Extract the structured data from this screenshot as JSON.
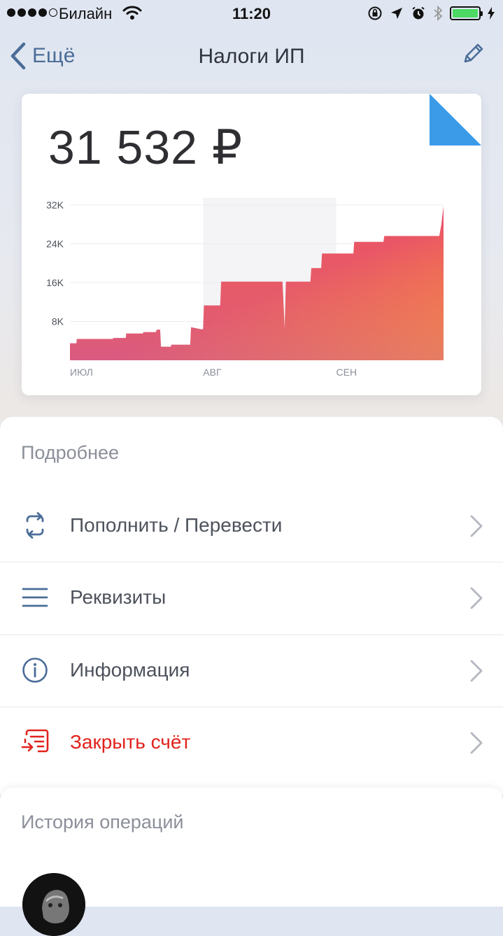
{
  "status_bar": {
    "carrier": "Билайн",
    "time": "11:20",
    "battery_level": 1.0,
    "icons": [
      "signal-dots-icon",
      "wifi-icon",
      "orientation-lock-icon",
      "location-icon",
      "alarm-icon",
      "bluetooth-icon",
      "battery-icon",
      "charging-icon"
    ]
  },
  "nav": {
    "back_label": "Ещё",
    "title": "Налоги ИП",
    "edit_icon": "pencil-icon"
  },
  "balance": {
    "amount": "31 532 ₽"
  },
  "colors": {
    "accent": "#4a6d99",
    "danger": "#e0241d",
    "corner_flag": "#3b9be8",
    "chart_top": "#ff9232",
    "chart_mid": "#e8506a",
    "chart_bottom": "#c8659a"
  },
  "chart_data": {
    "type": "area",
    "title": "",
    "xlabel": "",
    "ylabel": "",
    "ylim": [
      0,
      32000
    ],
    "y_ticks": [
      "32K",
      "24K",
      "16K",
      "8K"
    ],
    "y_tick_values": [
      32000,
      24000,
      16000,
      8000
    ],
    "x_tick_labels": [
      "ИЮЛ",
      "АВГ",
      "СЕН"
    ],
    "x_tick_days": [
      0,
      31,
      62
    ],
    "xlim": [
      0,
      87
    ],
    "grid": true,
    "series": [
      {
        "x": [
          0,
          1.5,
          1.6,
          10,
          10.1,
          13,
          13.1,
          17,
          17.1,
          20,
          20.2,
          21,
          21.2,
          23.5,
          23.6,
          28,
          28.2,
          30.5,
          31,
          31.2,
          35,
          35.2,
          49.5,
          50,
          50.3,
          51,
          51.3,
          56,
          56.2,
          58.5,
          58.7,
          66,
          66.2,
          73,
          73.2,
          86,
          86.5,
          87
        ],
        "y": [
          3500,
          3500,
          4400,
          4400,
          4600,
          4600,
          5500,
          5500,
          5800,
          5800,
          6300,
          6300,
          2800,
          2800,
          3200,
          3200,
          6800,
          6400,
          6400,
          11300,
          11300,
          16200,
          16200,
          6500,
          16200,
          16200,
          16200,
          16200,
          19000,
          19000,
          22000,
          22000,
          24400,
          24400,
          25600,
          25600,
          28000,
          31800
        ]
      }
    ]
  },
  "details": {
    "title": "Подробнее",
    "items": [
      {
        "label": "Пополнить / Перевести",
        "icon": "transfer-arrows-icon"
      },
      {
        "label": "Реквизиты",
        "icon": "list-lines-icon"
      },
      {
        "label": "Информация",
        "icon": "info-circle-icon"
      },
      {
        "label": "Закрыть счёт",
        "icon": "close-account-icon"
      }
    ]
  },
  "history": {
    "title": "История операций"
  }
}
